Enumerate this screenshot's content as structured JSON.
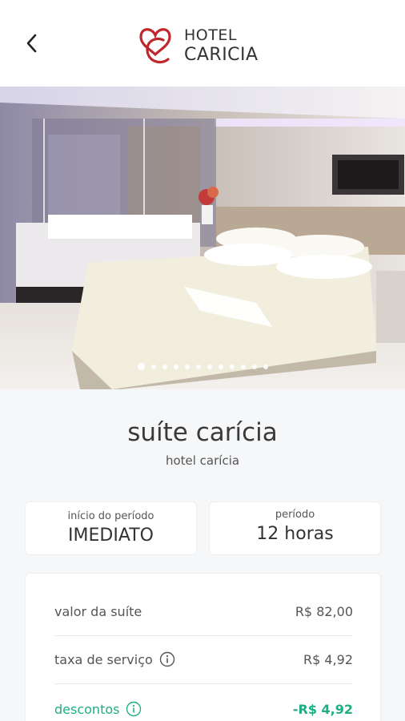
{
  "header": {
    "logo_line1": "HOTEL",
    "logo_line2": "CARICIA",
    "back_icon": "chevron-left-icon",
    "brand_color": "#c0272d"
  },
  "gallery": {
    "slide_count": 12,
    "active_index": 0
  },
  "room": {
    "title": "suíte carícia",
    "hotel": "hotel carícia"
  },
  "period_start": {
    "label": "início do período",
    "value": "IMEDIATO"
  },
  "period": {
    "label": "período",
    "value": "12 horas"
  },
  "prices": {
    "suite_label": "valor da suíte",
    "suite_value": "R$ 82,00",
    "service_label": "taxa de serviço",
    "service_value": "R$ 4,92",
    "discount_label": "descontos",
    "discount_value": "-R$ 4,92",
    "discount_color": "#1fae84"
  }
}
